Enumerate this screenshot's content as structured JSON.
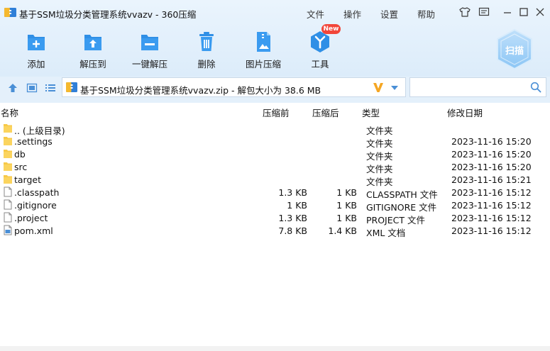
{
  "window": {
    "title": "基于SSM垃圾分类管理系统vvazv - 360压缩"
  },
  "menu": {
    "file": "文件",
    "operate": "操作",
    "settings": "设置",
    "help": "帮助"
  },
  "toolbar": {
    "add": "添加",
    "extract_to": "解压到",
    "one_click_extract": "一键解压",
    "delete": "删除",
    "image_compress": "图片压缩",
    "tools": "工具",
    "new_badge": "New",
    "scan": "扫描"
  },
  "address": {
    "text": "基于SSM垃圾分类管理系统vvazv.zip - 解包大小为 38.6 MB"
  },
  "columns": {
    "name": "名称",
    "packed": "压缩前",
    "size": "压缩后",
    "type": "类型",
    "modified": "修改日期"
  },
  "files": [
    {
      "name": ".. (上级目录)",
      "packed": "",
      "size": "",
      "type": "文件夹",
      "date": "",
      "icon": "folder-icon"
    },
    {
      "name": ".settings",
      "packed": "",
      "size": "",
      "type": "文件夹",
      "date": "2023-11-16 15:20",
      "icon": "folder-icon"
    },
    {
      "name": "db",
      "packed": "",
      "size": "",
      "type": "文件夹",
      "date": "2023-11-16 15:20",
      "icon": "folder-icon"
    },
    {
      "name": "src",
      "packed": "",
      "size": "",
      "type": "文件夹",
      "date": "2023-11-16 15:20",
      "icon": "folder-icon"
    },
    {
      "name": "target",
      "packed": "",
      "size": "",
      "type": "文件夹",
      "date": "2023-11-16 15:21",
      "icon": "folder-icon"
    },
    {
      "name": ".classpath",
      "packed": "1.3 KB",
      "size": "1 KB",
      "type": "CLASSPATH 文件",
      "date": "2023-11-16 15:12",
      "icon": "file-icon"
    },
    {
      "name": ".gitignore",
      "packed": "1 KB",
      "size": "1 KB",
      "type": "GITIGNORE 文件",
      "date": "2023-11-16 15:12",
      "icon": "file-icon"
    },
    {
      "name": ".project",
      "packed": "1.3 KB",
      "size": "1 KB",
      "type": "PROJECT 文件",
      "date": "2023-11-16 15:12",
      "icon": "file-icon"
    },
    {
      "name": "pom.xml",
      "packed": "7.8 KB",
      "size": "1.4 KB",
      "type": "XML 文档",
      "date": "2023-11-16 15:12",
      "icon": "xml-file-icon"
    }
  ],
  "colors": {
    "accent": "#2f8fe6",
    "folder": "#f7c948",
    "badge": "#f2463a"
  }
}
